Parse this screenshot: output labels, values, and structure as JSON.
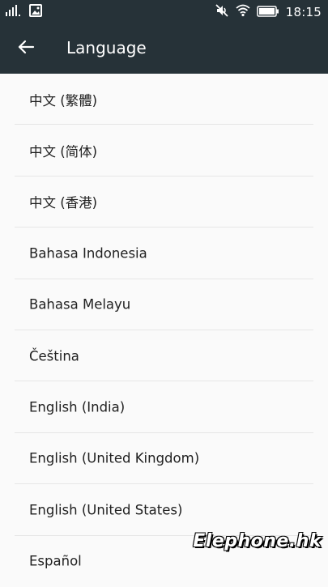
{
  "status_bar": {
    "time": "18:15",
    "icons": [
      "signal-icon",
      "image-notification-icon",
      "mute-icon",
      "wifi-icon",
      "battery-icon"
    ]
  },
  "app_bar": {
    "title": "Language",
    "back_icon": "arrow-left-icon"
  },
  "languages": [
    {
      "label": "中文 (繁體)"
    },
    {
      "label": "中文 (简体)"
    },
    {
      "label": "中文 (香港)"
    },
    {
      "label": "Bahasa Indonesia"
    },
    {
      "label": "Bahasa Melayu"
    },
    {
      "label": "Čeština"
    },
    {
      "label": "English (India)"
    },
    {
      "label": "English (United Kingdom)"
    },
    {
      "label": "English (United States)"
    },
    {
      "label": "Español"
    }
  ],
  "watermark": "Elephone.hk",
  "colors": {
    "app_bar_bg": "#263238",
    "background": "#fafafa",
    "text_primary": "#212121",
    "divider": "#e6e6e6"
  }
}
